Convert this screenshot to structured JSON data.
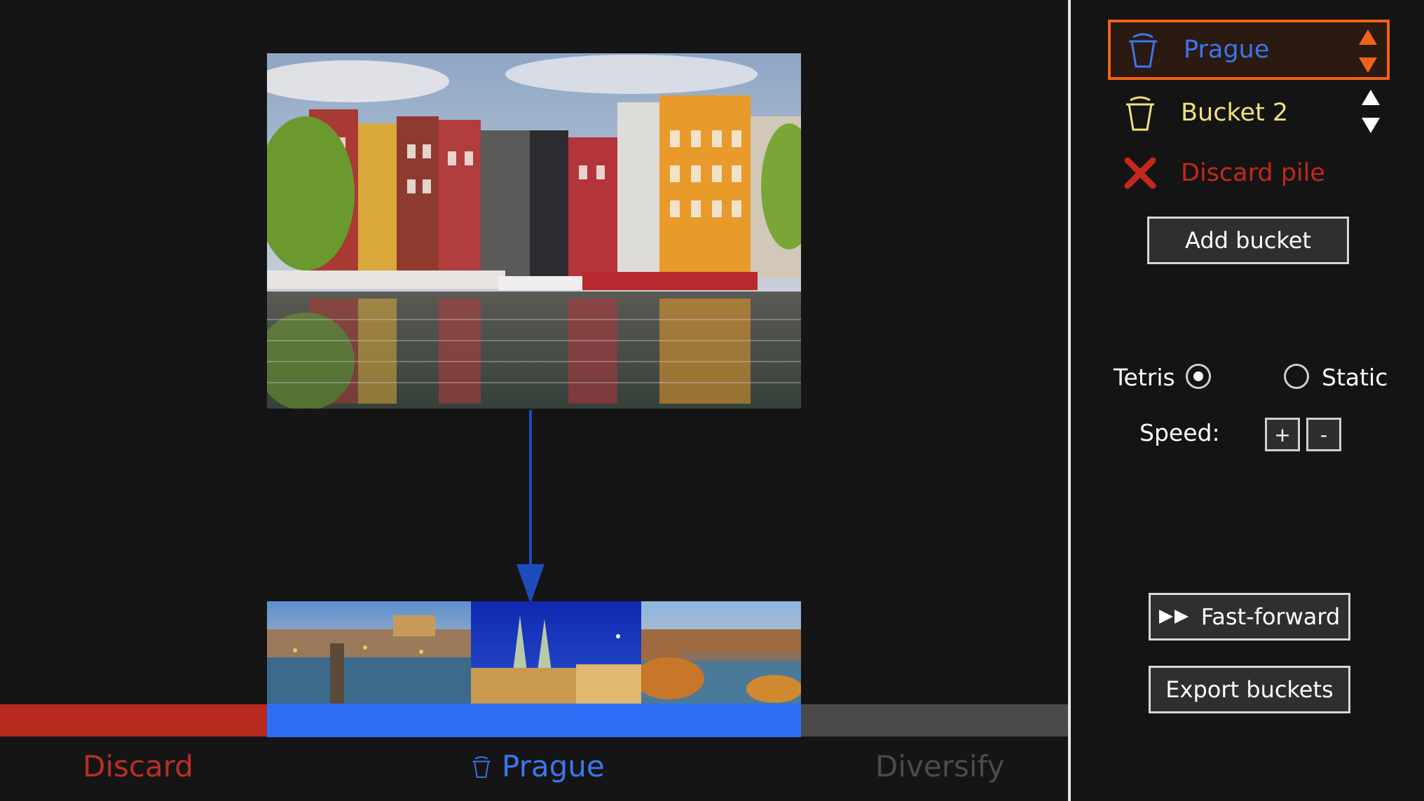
{
  "buckets": [
    {
      "label": "Prague",
      "color": "#3b76ee",
      "selected": true
    },
    {
      "label": "Bucket 2",
      "color": "#f1e07a",
      "selected": false
    },
    {
      "label": "Discard pile",
      "color": "#c2281c",
      "selected": false
    }
  ],
  "sidebar": {
    "add_bucket_label": "Add bucket",
    "mode_tetris_label": "Tetris",
    "mode_static_label": "Static",
    "mode_selected": "Tetris",
    "speed_label": "Speed:",
    "speed_plus_label": "+",
    "speed_minus_label": "-",
    "fast_forward_label": "Fast-forward",
    "export_label": "Export buckets"
  },
  "bottom": {
    "discard_label": "Discard",
    "prague_label": "Prague",
    "diversify_label": "Diversify"
  },
  "colors": {
    "accent_orange": "#f26317",
    "discard_red": "#b82a1d",
    "prague_blue": "#2e6ef7",
    "neutral_gray": "#4a4a4a"
  }
}
